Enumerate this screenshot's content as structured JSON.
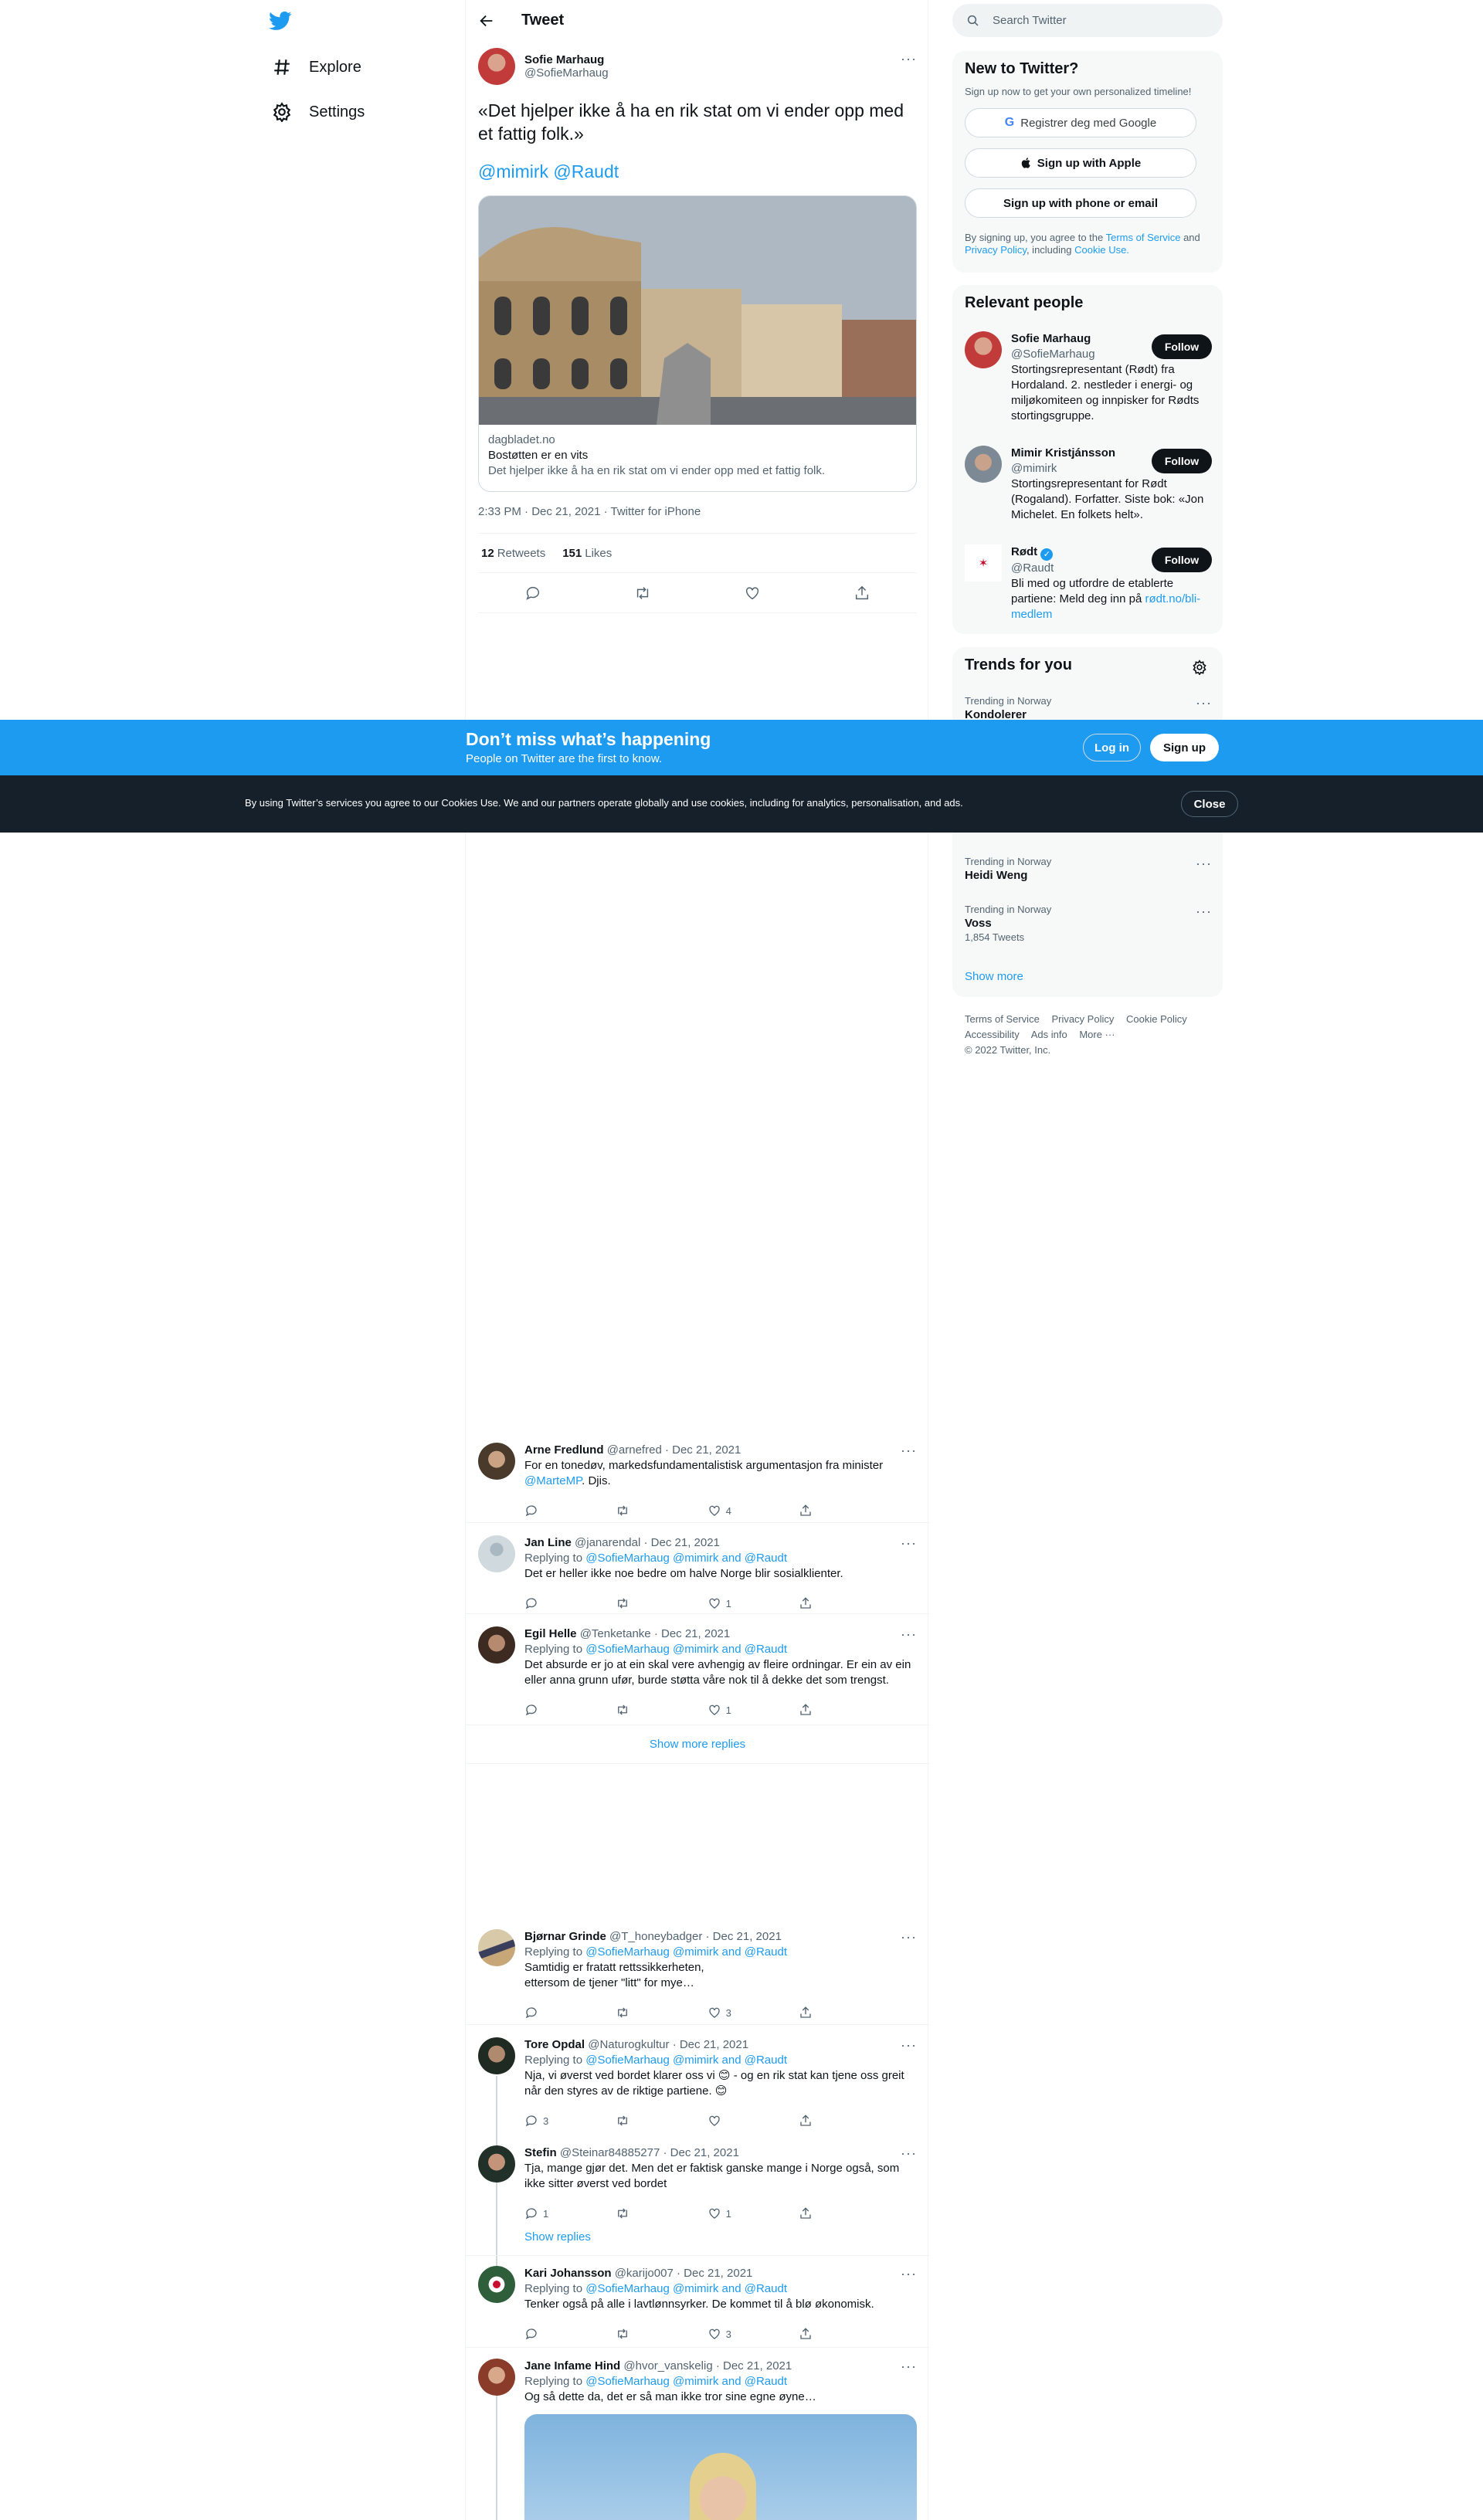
{
  "nav": {
    "logo": "twitter-bird-icon",
    "items": [
      {
        "label": "Explore",
        "icon": "hashtag-icon"
      },
      {
        "label": "Settings",
        "icon": "gear-icon"
      }
    ]
  },
  "main": {
    "header_title": "Tweet",
    "tweet": {
      "name": "Sofie Marhaug",
      "handle": "@SofieMarhaug",
      "text": "«Det hjelper ikke å ha en rik stat om vi ender opp med et fattig folk.»",
      "mentions": "@mimirk @Raudt",
      "card": {
        "domain": "dagbladet.no",
        "title": "Bostøtten er en vits",
        "description": "Det hjelper ikke å ha en rik stat om vi ender opp med et fattig folk."
      },
      "timestamp": "2:33 PM · Dec 21, 2021 · Twitter for iPhone",
      "retweets_count": "12",
      "retweets_label": "Retweets",
      "likes_count": "151",
      "likes_label": "Likes"
    },
    "replies_group1": [
      {
        "name": "Arne Fredlund",
        "handle": "@arnefred",
        "date": "· Dec 21, 2021",
        "replying": "",
        "text": "For en tonedøv, markedsfundamentalistisk  argumentasjon fra minister",
        "text_link": "@MarteMP",
        "text_after": ". Djis.",
        "likes": "4"
      },
      {
        "name": "Jan Line",
        "handle": "@janarendal",
        "date": "· Dec 21, 2021",
        "replying": "Replying to",
        "replying_to": "@SofieMarhaug @mimirk and @Raudt",
        "text": "Det er heller ikke noe bedre om halve Norge blir sosialklienter.",
        "likes": "1"
      },
      {
        "name": "Egil Helle",
        "handle": "@Tenketanke",
        "date": "· Dec 21, 2021",
        "replying": "Replying to",
        "replying_to": "@SofieMarhaug @mimirk and @Raudt",
        "text": "Det absurde er jo at ein skal vere avhengig av fleire ordningar. Er ein av ein eller anna grunn ufør, burde støtta våre nok til å dekke det som trengst.",
        "likes": "1"
      }
    ],
    "show_more_replies": "Show more replies",
    "replies_group2": [
      {
        "name": "Bjørnar Grinde",
        "handle": "@T_honeybadger",
        "date": "· Dec 21, 2021",
        "replying": "Replying to",
        "replying_to": "@SofieMarhaug @mimirk and @Raudt",
        "text_line1": "Samtidig er fratatt rettssikkerheten,",
        "text_line2": "ettersom de tjener \"litt\" for mye…",
        "likes": "3"
      },
      {
        "name": "Tore Opdal",
        "handle": "@Naturogkultur",
        "date": "· Dec 21, 2021",
        "replying": "Replying to",
        "replying_to": "@SofieMarhaug @mimirk and @Raudt",
        "text": "Nja, vi øverst ved bordet klarer oss vi 😊 - og en rik stat kan tjene oss greit når den styres av de riktige partiene. 😊",
        "replies": "3"
      },
      {
        "name": "Stefin",
        "handle": "@Steinar84885277",
        "date": "· Dec 21, 2021",
        "text": "Tja, mange gjør det. Men det er faktisk ganske mange i Norge også, som ikke sitter øverst ved bordet",
        "replies": "1",
        "likes": "1"
      },
      {
        "name": "Kari Johansson",
        "handle": "@karijo007",
        "date": "· Dec 21, 2021",
        "replying": "Replying to",
        "replying_to": "@SofieMarhaug @mimirk and @Raudt",
        "text": "Tenker også på alle i lavtlønnsyrker. De kommet til å blø økonomisk.",
        "likes": "3"
      },
      {
        "name": "Jane Infame Hind",
        "handle": "@hvor_vanskelig",
        "date": "· Dec 21, 2021",
        "replying": "Replying to",
        "replying_to": "@SofieMarhaug @mimirk and @Raudt",
        "text": "Og så dette da, det er så man ikke tror sine egne øyne…"
      }
    ],
    "show_replies": "Show replies"
  },
  "sidebar": {
    "search_placeholder": "Search Twitter",
    "new": {
      "title": "New to Twitter?",
      "subtitle": "Sign up now to get your own personalized timeline!",
      "google": "Registrer deg med Google",
      "apple": "Sign up with Apple",
      "phone": "Sign up with phone or email",
      "legal_prefix": "By signing up, you agree to the",
      "tos": "Terms of Service",
      "and": "and",
      "privacy": "Privacy Policy",
      "including": ", including",
      "cookie": "Cookie Use."
    },
    "people": {
      "title": "Relevant people",
      "follow_label": "Follow",
      "list": [
        {
          "name": "Sofie Marhaug",
          "handle": "@SofieMarhaug",
          "bio": "Stortingsrepresentant (Rødt) fra Hordaland. 2. nestleder i energi- og miljøkomiteen og innpisker for Rødts stortingsgruppe."
        },
        {
          "name": "Mimir Kristjánsson",
          "handle": "@mimirk",
          "bio": "Stortingsrepresentant for Rødt (Rogaland). Forfatter. Siste bok: «Jon Michelet. En folkets helt»."
        },
        {
          "name": "Rødt",
          "handle": "@Raudt",
          "bio": "Bli med og utfordre de etablerte partiene: Meld deg inn på",
          "bio_link": "rødt.no/bli-medlem"
        }
      ]
    },
    "trends": {
      "title": "Trends for you",
      "items": [
        {
          "context": "Trending in Norway",
          "name": "Kondolerer",
          "count": ""
        },
        {
          "context": "Trending in Norway",
          "name": "Heidi Weng",
          "count": ""
        },
        {
          "context": "Trending in Norway",
          "name": "Voss",
          "count": "1,854 Tweets"
        }
      ],
      "show_more": "Show more"
    },
    "footer": {
      "links": [
        "Terms of Service",
        "Privacy Policy",
        "Cookie Policy",
        "Accessibility",
        "Ads info",
        "More ···"
      ],
      "copyright": "© 2022 Twitter, Inc."
    }
  },
  "signup_bar": {
    "title": "Don’t miss what’s happening",
    "subtitle": "People on Twitter are the first to know.",
    "login": "Log in",
    "signup": "Sign up"
  },
  "cookie_bar": {
    "text": "By using Twitter’s services you agree to our Cookies Use. We and our partners operate globally and use cookies, including for analytics, personalisation, and ads.",
    "close": "Close"
  },
  "colors": {
    "accent": "#1d9bf0",
    "text": "#0f1419",
    "muted": "#536471",
    "cookie_bg": "#15202b"
  }
}
